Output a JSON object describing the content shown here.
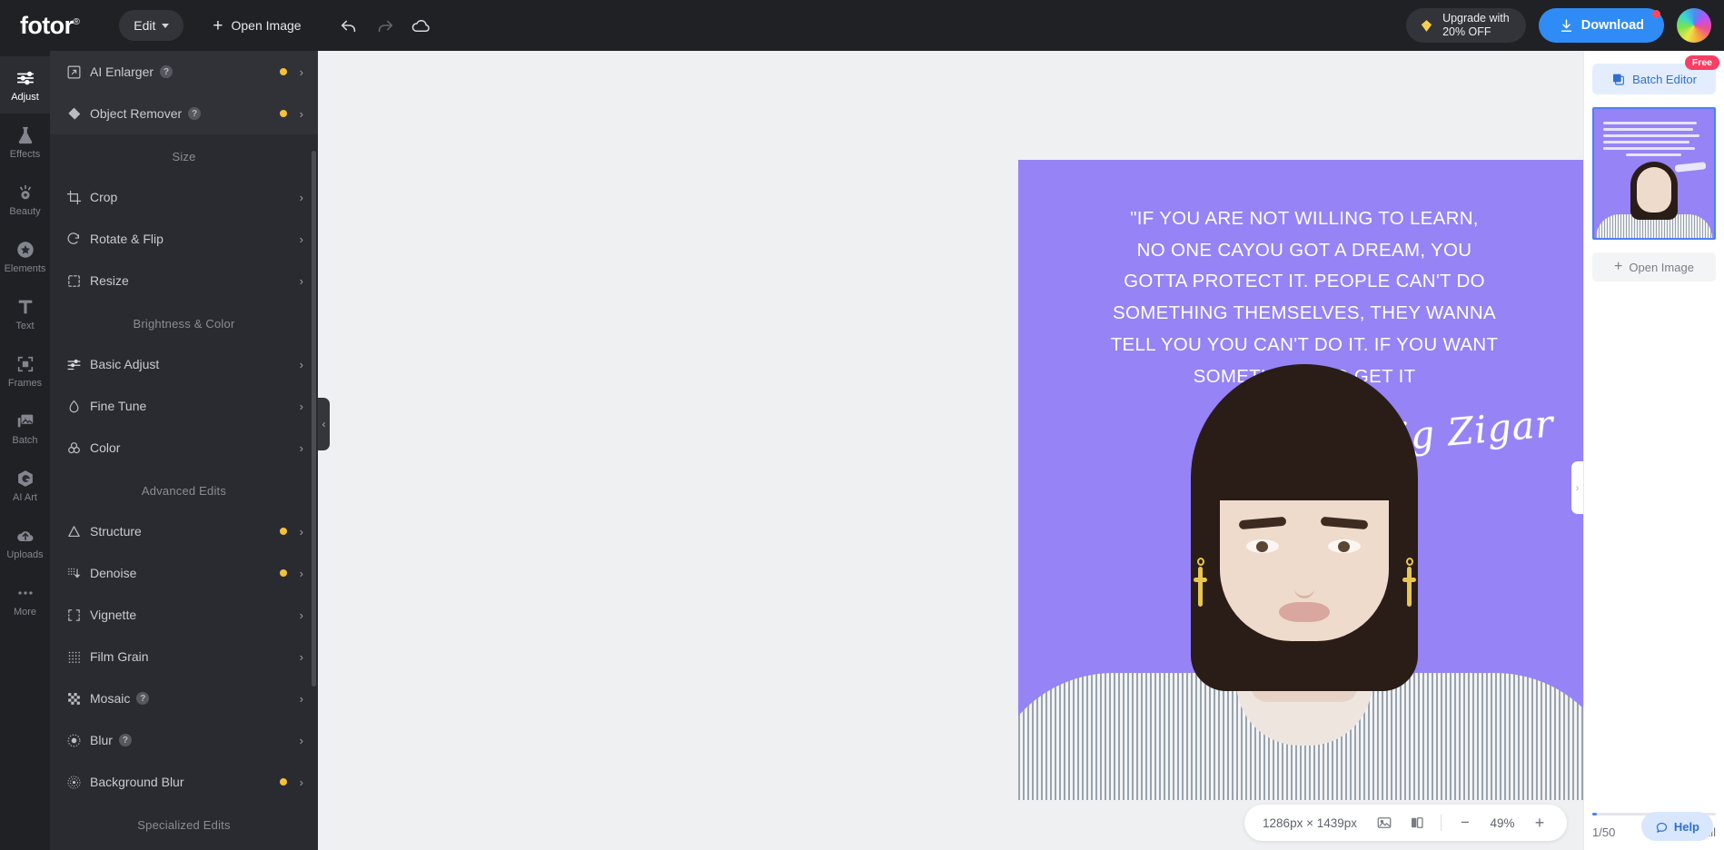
{
  "topbar": {
    "logo": "fotor",
    "logo_reg": "®",
    "edit_label": "Edit",
    "open_image_label": "Open Image",
    "undo_icon": "undo-icon",
    "redo_icon": "redo-icon",
    "cloud_icon": "cloud-icon",
    "upgrade_line1": "Upgrade with",
    "upgrade_line2": "20% OFF",
    "download_label": "Download",
    "accent_blue": "#2f8cf6",
    "notify_red": "#ff4757"
  },
  "rail": {
    "items": [
      {
        "label": "Adjust",
        "icon": "sliders-icon",
        "active": true
      },
      {
        "label": "Effects",
        "icon": "flask-icon",
        "active": false
      },
      {
        "label": "Beauty",
        "icon": "eye-icon",
        "active": false
      },
      {
        "label": "Elements",
        "icon": "star-badge-icon",
        "active": false
      },
      {
        "label": "Text",
        "icon": "text-t-icon",
        "active": false
      },
      {
        "label": "Frames",
        "icon": "frame-icon",
        "active": false
      },
      {
        "label": "Batch",
        "icon": "photos-icon",
        "active": false
      },
      {
        "label": "AI Art",
        "icon": "ai-art-icon",
        "active": false
      },
      {
        "label": "Uploads",
        "icon": "upload-cloud-icon",
        "active": false
      },
      {
        "label": "More",
        "icon": "ellipsis-icon",
        "active": false
      }
    ]
  },
  "panel": {
    "badge_color": "#f5c13d",
    "groups": [
      {
        "title": null,
        "items": [
          {
            "label": "AI Enlarger",
            "icon": "ai-enlarger-icon",
            "help": true,
            "badge": true,
            "highlight": true
          },
          {
            "label": "Object Remover",
            "icon": "eraser-icon",
            "help": true,
            "badge": true,
            "highlight": true
          }
        ]
      },
      {
        "title": "Size",
        "items": [
          {
            "label": "Crop",
            "icon": "crop-icon",
            "help": false,
            "badge": false,
            "highlight": false
          },
          {
            "label": "Rotate & Flip",
            "icon": "rotate-icon",
            "help": false,
            "badge": false,
            "highlight": false
          },
          {
            "label": "Resize",
            "icon": "resize-icon",
            "help": false,
            "badge": false,
            "highlight": false
          }
        ]
      },
      {
        "title": "Brightness & Color",
        "items": [
          {
            "label": "Basic Adjust",
            "icon": "sliders-icon",
            "help": false,
            "badge": false,
            "highlight": false
          },
          {
            "label": "Fine Tune",
            "icon": "droplet-icon",
            "help": false,
            "badge": false,
            "highlight": false
          },
          {
            "label": "Color",
            "icon": "color-circles-icon",
            "help": false,
            "badge": false,
            "highlight": false
          }
        ]
      },
      {
        "title": "Advanced Edits",
        "items": [
          {
            "label": "Structure",
            "icon": "triangle-icon",
            "help": false,
            "badge": true,
            "highlight": false
          },
          {
            "label": "Denoise",
            "icon": "denoise-icon",
            "help": false,
            "badge": true,
            "highlight": false
          },
          {
            "label": "Vignette",
            "icon": "vignette-icon",
            "help": false,
            "badge": false,
            "highlight": false
          },
          {
            "label": "Film Grain",
            "icon": "grain-icon",
            "help": false,
            "badge": false,
            "highlight": false
          },
          {
            "label": "Mosaic",
            "icon": "mosaic-icon",
            "help": true,
            "badge": false,
            "highlight": false
          },
          {
            "label": "Blur",
            "icon": "blur-icon",
            "help": true,
            "badge": false,
            "highlight": false
          },
          {
            "label": "Background Blur",
            "icon": "background-blur-icon",
            "help": false,
            "badge": true,
            "highlight": false
          }
        ]
      },
      {
        "title": "Specialized Edits",
        "items": []
      }
    ],
    "help_glyph": "?",
    "chevron_glyph": "›",
    "collapse_left_glyph": "‹"
  },
  "canvas": {
    "background": "#eff0f2",
    "image": {
      "bg_color": "#9683f5",
      "quote_lines": [
        "\"IF YOU ARE NOT WILLING TO LEARN,",
        "NO ONE CAYOU GOT A DREAM, YOU",
        "GOTTA PROTECT IT. PEOPLE CAN'T DO",
        "SOMETHING THEMSELVES, THEY WANNA",
        "TELL YOU YOU CAN'T DO IT. IF YOU WANT",
        "SOMETHING, GO GET IT"
      ],
      "signature": "Zig Zigar"
    },
    "collapse_right_glyph": "›"
  },
  "bottombar": {
    "dimensions": "1286px × 1439px",
    "fit_icon": "fit-image-icon",
    "compare_icon": "compare-icon",
    "zoom_out_label": "−",
    "zoom_value": "49%",
    "zoom_in_label": "+"
  },
  "right_panel": {
    "batch_editor_label": "Batch Editor",
    "batch_editor_icon": "batch-layers-icon",
    "free_badge": "Free",
    "open_image_label": "Open Image",
    "count": "1/50",
    "clear_all_label": "Clear All",
    "trash_icon": "trash-icon",
    "help_label": "Help",
    "help_icon": "chat-bubble-icon",
    "thumbnail": {
      "bg_color": "#9683f5",
      "selected": true
    }
  }
}
